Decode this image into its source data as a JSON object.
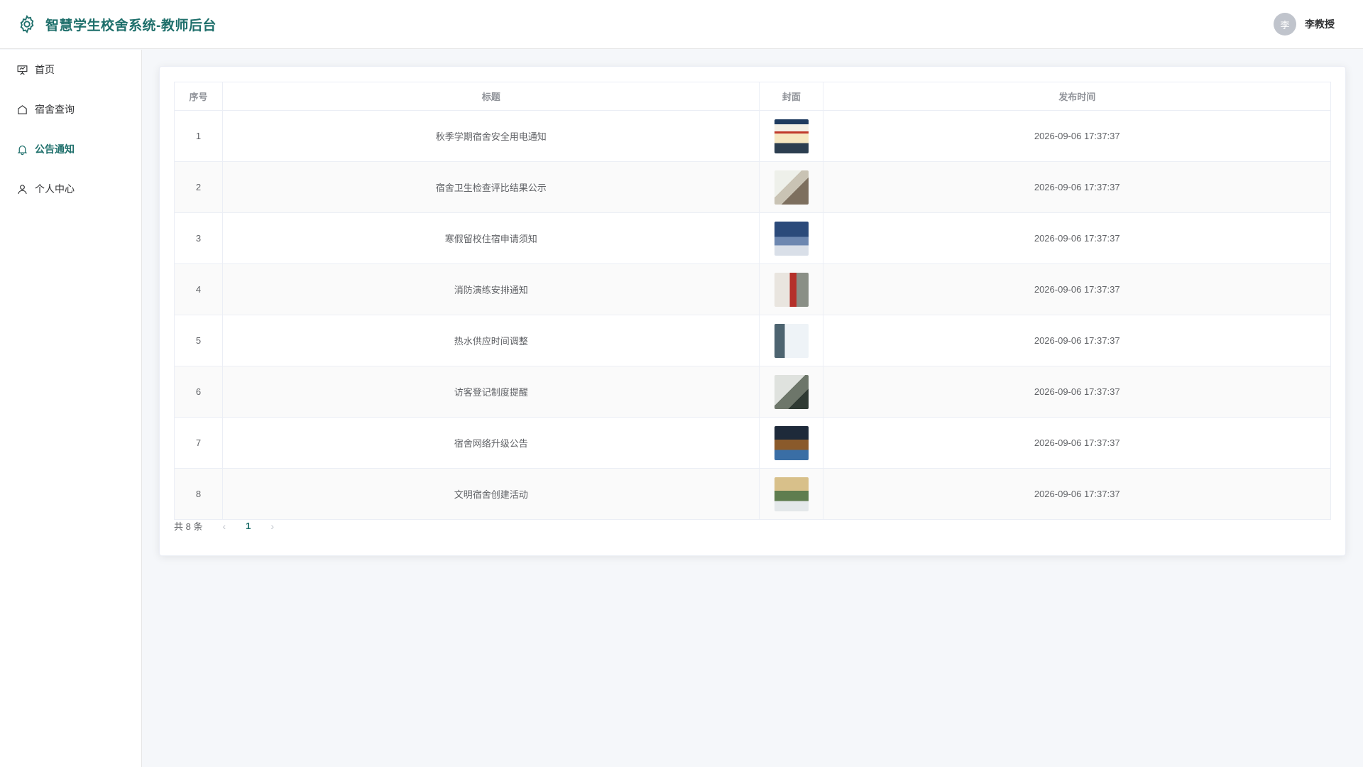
{
  "header": {
    "title": "智慧学生校舍系统-教师后台",
    "avatar_text": "李",
    "username": "李教授",
    "accent": "#1e6f6b"
  },
  "sidebar": {
    "items": [
      {
        "label": "首页",
        "icon": "presentation-board-icon",
        "active": false
      },
      {
        "label": "宿舍查询",
        "icon": "home-icon",
        "active": false
      },
      {
        "label": "公告通知",
        "icon": "bell-icon",
        "active": true
      },
      {
        "label": "个人中心",
        "icon": "user-icon",
        "active": false
      }
    ]
  },
  "table": {
    "columns": [
      "序号",
      "标题",
      "封面",
      "发布时间"
    ],
    "rows": [
      {
        "index": "1",
        "title": "秋季学期宿舍安全用电通知",
        "time": "2026-09-06 17:37:37"
      },
      {
        "index": "2",
        "title": "宿舍卫生检查评比结果公示",
        "time": "2026-09-06 17:37:37"
      },
      {
        "index": "3",
        "title": "寒假留校住宿申请须知",
        "time": "2026-09-06 17:37:37"
      },
      {
        "index": "4",
        "title": "消防演练安排通知",
        "time": "2026-09-06 17:37:37"
      },
      {
        "index": "5",
        "title": "热水供应时间调整",
        "time": "2026-09-06 17:37:37"
      },
      {
        "index": "6",
        "title": "访客登记制度提醒",
        "time": "2026-09-06 17:37:37"
      },
      {
        "index": "7",
        "title": "宿舍网络升级公告",
        "time": "2026-09-06 17:37:37"
      },
      {
        "index": "8",
        "title": "文明宿舍创建活动",
        "time": "2026-09-06 17:37:37"
      }
    ]
  },
  "pagination": {
    "total_label": "共 8 条",
    "current_page": "1"
  }
}
